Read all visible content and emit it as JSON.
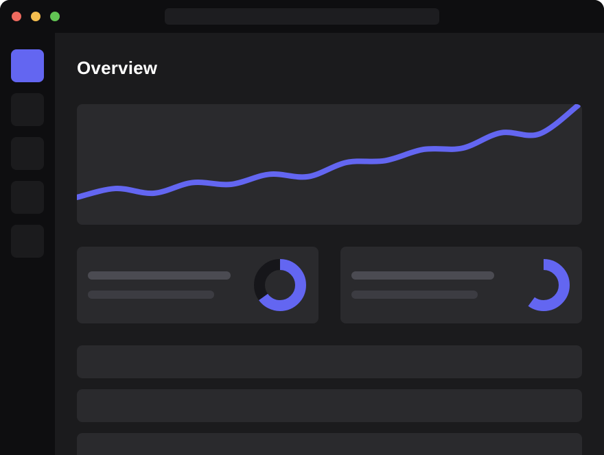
{
  "window": {
    "address_bar_text": ""
  },
  "page": {
    "title": "Overview"
  },
  "colors": {
    "accent": "#6366f1",
    "traffic_red": "#ee6a5f",
    "traffic_yellow": "#f5be4f",
    "traffic_green": "#62c454",
    "donut_track": "#16161a"
  },
  "sidebar": {
    "items": [
      {
        "name": "item-1",
        "active": true
      },
      {
        "name": "item-2",
        "active": false
      },
      {
        "name": "item-3",
        "active": false
      },
      {
        "name": "item-4",
        "active": false
      },
      {
        "name": "item-5",
        "active": false
      }
    ]
  },
  "stats": [
    {
      "progress": 0.65,
      "show_track": true
    },
    {
      "progress": 0.6,
      "show_track": false
    }
  ],
  "chart_data": {
    "type": "line",
    "title": "",
    "xlabel": "",
    "ylabel": "",
    "grid": false,
    "series": [
      {
        "values": [
          15,
          30,
          22,
          40,
          37,
          54,
          50,
          74,
          77,
          96,
          98,
          124,
          122,
          170
        ]
      }
    ]
  }
}
